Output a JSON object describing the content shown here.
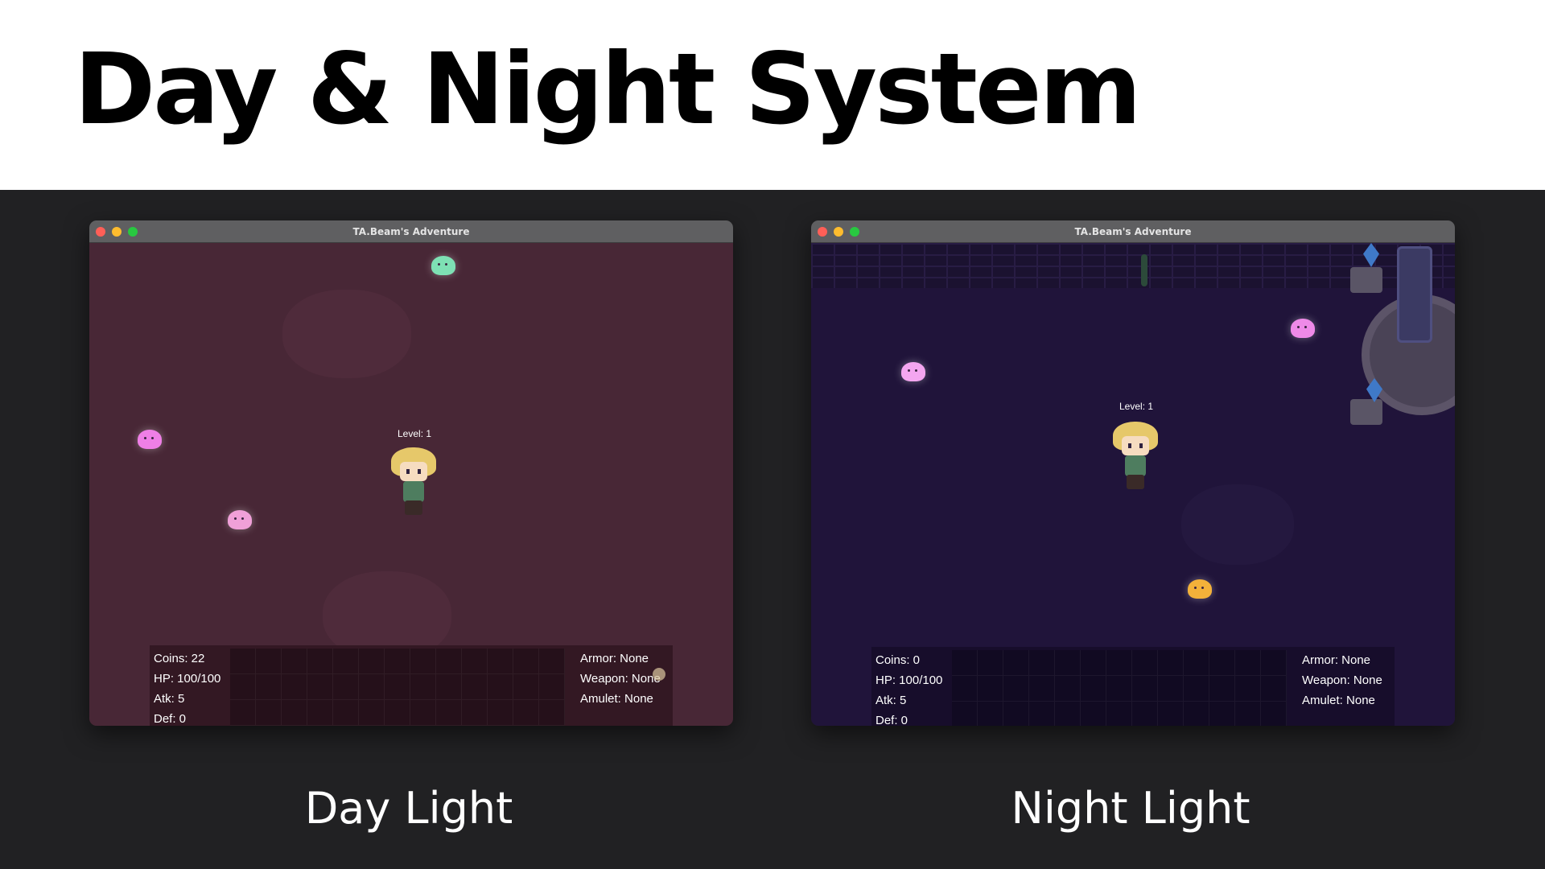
{
  "page": {
    "title": "Day & Night System",
    "background": "#212123"
  },
  "panels": [
    {
      "id": "day",
      "window_title": "TA.Beam's Adventure",
      "caption": "Day Light",
      "tint": "#482736",
      "player": {
        "level_text": "Level: 1",
        "sprite": "hero-sprite"
      },
      "enemies": [
        {
          "sprite": "slime",
          "color": "#7ee0b4"
        },
        {
          "sprite": "slime",
          "color": "#ef7fe6"
        },
        {
          "sprite": "slime",
          "color": "#f0a0d8"
        }
      ],
      "hud": {
        "stats": [
          "Coins: 22",
          "HP: 100/100",
          "Atk: 5",
          "Def: 0"
        ],
        "equipment": [
          "Armor: None",
          "Weapon: None",
          "Amulet: None"
        ],
        "inventory": {
          "columns": 13,
          "rows": 3
        }
      }
    },
    {
      "id": "night",
      "window_title": "TA.Beam's Adventure",
      "caption": "Night Light",
      "tint": "#20143a",
      "player": {
        "level_text": "Level: 1",
        "sprite": "hero-sprite"
      },
      "enemies": [
        {
          "sprite": "slime",
          "color": "#f4a6f0"
        },
        {
          "sprite": "slime",
          "color": "#ee8ae8"
        },
        {
          "sprite": "slime",
          "color": "#f3b13a"
        }
      ],
      "hud": {
        "stats": [
          "Coins: 0",
          "HP: 100/100",
          "Atk: 5",
          "Def: 0"
        ],
        "equipment": [
          "Armor: None",
          "Weapon: None",
          "Amulet: None"
        ],
        "inventory": {
          "columns": 13,
          "rows": 3
        }
      }
    }
  ]
}
